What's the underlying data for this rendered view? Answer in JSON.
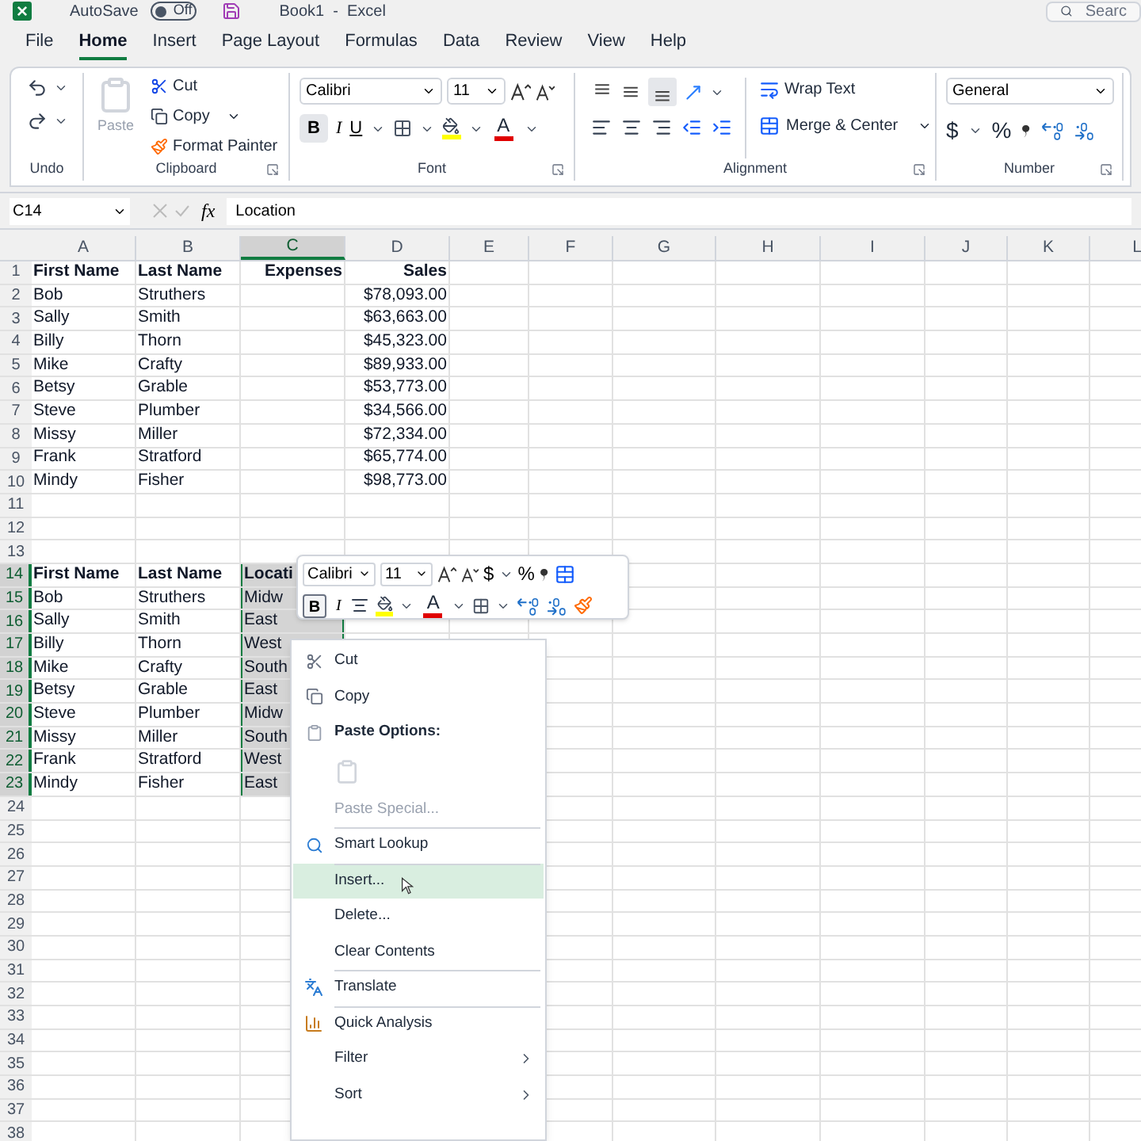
{
  "title_bar": {
    "autosave_label": "AutoSave",
    "autosave_state": "Off",
    "autosave_on": false,
    "document_title": "Book1  -  Excel",
    "search_placeholder": "Searc"
  },
  "tabs": [
    {
      "label": "File",
      "selected": false
    },
    {
      "label": "Home",
      "selected": true
    },
    {
      "label": "Insert",
      "selected": false
    },
    {
      "label": "Page Layout",
      "selected": false
    },
    {
      "label": "Formulas",
      "selected": false
    },
    {
      "label": "Data",
      "selected": false
    },
    {
      "label": "Review",
      "selected": false
    },
    {
      "label": "View",
      "selected": false
    },
    {
      "label": "Help",
      "selected": false
    }
  ],
  "ribbon": {
    "undo_group": "Undo",
    "clipboard": {
      "label": "Clipboard",
      "paste": "Paste",
      "paste_disabled": true,
      "cut": "Cut",
      "copy": "Copy",
      "format_painter": "Format Painter"
    },
    "font": {
      "label": "Font",
      "font_name": "Calibri",
      "font_size": "11",
      "bold": "B",
      "bold_selected": true,
      "italic": "I",
      "underline": "U",
      "font_color_letter": "A"
    },
    "alignment": {
      "label": "Alignment",
      "wrap_text": "Wrap Text",
      "merge_center": "Merge & Center",
      "bottom_align_selected": true
    },
    "number": {
      "label": "Number",
      "format": "General",
      "currency": "$",
      "percent": "%"
    }
  },
  "formula_bar": {
    "name_box": "C14",
    "fx": "fx",
    "value": "Location"
  },
  "grid": {
    "columns": [
      {
        "label": "A",
        "selected": false
      },
      {
        "label": "B",
        "selected": false
      },
      {
        "label": "C",
        "selected": true
      },
      {
        "label": "D",
        "selected": false
      },
      {
        "label": "E",
        "selected": false
      },
      {
        "label": "F",
        "selected": false
      },
      {
        "label": "G",
        "selected": false
      },
      {
        "label": "H",
        "selected": false
      },
      {
        "label": "I",
        "selected": false
      },
      {
        "label": "J",
        "selected": false
      },
      {
        "label": "K",
        "selected": false
      },
      {
        "label": "L",
        "selected": false
      }
    ],
    "rows": [
      {
        "number": "1",
        "selected": false,
        "bold": true,
        "cells": [
          {
            "text": "First Name"
          },
          {
            "text": "Last Name"
          },
          {
            "text": "Expenses",
            "right_aligned": true
          },
          {
            "text": "Sales",
            "right_aligned": true
          }
        ]
      },
      {
        "number": "2",
        "selected": false,
        "bold": false,
        "cells": [
          {
            "text": "Bob"
          },
          {
            "text": "Struthers"
          },
          {
            "text": ""
          },
          {
            "text": "$78,093.00",
            "right_aligned": true
          }
        ]
      },
      {
        "number": "3",
        "selected": false,
        "bold": false,
        "cells": [
          {
            "text": "Sally"
          },
          {
            "text": "Smith"
          },
          {
            "text": ""
          },
          {
            "text": "$63,663.00",
            "right_aligned": true
          }
        ]
      },
      {
        "number": "4",
        "selected": false,
        "bold": false,
        "cells": [
          {
            "text": "Billy"
          },
          {
            "text": "Thorn"
          },
          {
            "text": ""
          },
          {
            "text": "$45,323.00",
            "right_aligned": true
          }
        ]
      },
      {
        "number": "5",
        "selected": false,
        "bold": false,
        "cells": [
          {
            "text": "Mike"
          },
          {
            "text": "Crafty"
          },
          {
            "text": ""
          },
          {
            "text": "$89,933.00",
            "right_aligned": true
          }
        ]
      },
      {
        "number": "6",
        "selected": false,
        "bold": false,
        "cells": [
          {
            "text": "Betsy"
          },
          {
            "text": "Grable"
          },
          {
            "text": ""
          },
          {
            "text": "$53,773.00",
            "right_aligned": true
          }
        ]
      },
      {
        "number": "7",
        "selected": false,
        "bold": false,
        "cells": [
          {
            "text": "Steve"
          },
          {
            "text": "Plumber"
          },
          {
            "text": ""
          },
          {
            "text": "$34,566.00",
            "right_aligned": true
          }
        ]
      },
      {
        "number": "8",
        "selected": false,
        "bold": false,
        "cells": [
          {
            "text": "Missy"
          },
          {
            "text": "Miller"
          },
          {
            "text": ""
          },
          {
            "text": "$72,334.00",
            "right_aligned": true
          }
        ]
      },
      {
        "number": "9",
        "selected": false,
        "bold": false,
        "cells": [
          {
            "text": "Frank"
          },
          {
            "text": "Stratford"
          },
          {
            "text": ""
          },
          {
            "text": "$65,774.00",
            "right_aligned": true
          }
        ]
      },
      {
        "number": "10",
        "selected": false,
        "bold": false,
        "cells": [
          {
            "text": "Mindy"
          },
          {
            "text": "Fisher"
          },
          {
            "text": ""
          },
          {
            "text": "$98,773.00",
            "right_aligned": true
          }
        ]
      },
      {
        "number": "11",
        "selected": false
      },
      {
        "number": "12",
        "selected": false
      },
      {
        "number": "13",
        "selected": false
      },
      {
        "number": "14",
        "selected": true,
        "bold": true,
        "cells": [
          {
            "text": "First Name"
          },
          {
            "text": "Last Name"
          },
          {
            "text": "Locati",
            "selected": true
          }
        ]
      },
      {
        "number": "15",
        "selected": true,
        "bold": false,
        "cells": [
          {
            "text": "Bob"
          },
          {
            "text": "Struthers"
          },
          {
            "text": "Midw",
            "selected": true
          }
        ]
      },
      {
        "number": "16",
        "selected": true,
        "bold": false,
        "cells": [
          {
            "text": "Sally"
          },
          {
            "text": "Smith"
          },
          {
            "text": "East",
            "selected": true
          }
        ]
      },
      {
        "number": "17",
        "selected": true,
        "bold": false,
        "cells": [
          {
            "text": "Billy"
          },
          {
            "text": "Thorn"
          },
          {
            "text": "West",
            "selected": true
          }
        ]
      },
      {
        "number": "18",
        "selected": true,
        "bold": false,
        "cells": [
          {
            "text": "Mike"
          },
          {
            "text": "Crafty"
          },
          {
            "text": "South",
            "selected": true
          }
        ]
      },
      {
        "number": "19",
        "selected": true,
        "bold": false,
        "cells": [
          {
            "text": "Betsy"
          },
          {
            "text": "Grable"
          },
          {
            "text": "East",
            "selected": true
          }
        ]
      },
      {
        "number": "20",
        "selected": true,
        "bold": false,
        "cells": [
          {
            "text": "Steve"
          },
          {
            "text": "Plumber"
          },
          {
            "text": "Midw",
            "selected": true
          }
        ]
      },
      {
        "number": "21",
        "selected": true,
        "bold": false,
        "cells": [
          {
            "text": "Missy"
          },
          {
            "text": "Miller"
          },
          {
            "text": "South",
            "selected": true
          }
        ]
      },
      {
        "number": "22",
        "selected": true,
        "bold": false,
        "cells": [
          {
            "text": "Frank"
          },
          {
            "text": "Stratford"
          },
          {
            "text": "West",
            "selected": true
          }
        ]
      },
      {
        "number": "23",
        "selected": true,
        "bold": false,
        "cells": [
          {
            "text": "Mindy"
          },
          {
            "text": "Fisher"
          },
          {
            "text": "East",
            "selected": true
          }
        ]
      },
      {
        "number": "24",
        "selected": false
      },
      {
        "number": "25",
        "selected": false
      },
      {
        "number": "26",
        "selected": false
      },
      {
        "number": "27",
        "selected": false
      },
      {
        "number": "28",
        "selected": false
      },
      {
        "number": "29",
        "selected": false
      },
      {
        "number": "30",
        "selected": false
      },
      {
        "number": "31",
        "selected": false
      },
      {
        "number": "32",
        "selected": false
      },
      {
        "number": "33",
        "selected": false
      },
      {
        "number": "34",
        "selected": false
      },
      {
        "number": "35",
        "selected": false
      },
      {
        "number": "36",
        "selected": false
      },
      {
        "number": "37",
        "selected": false
      },
      {
        "number": "38",
        "selected": false
      }
    ]
  },
  "mini_toolbar": {
    "font_name": "Calibri",
    "font_size": "11",
    "currency": "$",
    "percent": "%",
    "bold": "B",
    "bold_selected": true,
    "italic": "I",
    "font_color_letter": "A"
  },
  "context_menu": [
    {
      "kind": "cut",
      "label": "Cut",
      "disabled": false,
      "selected": false,
      "divider_above": false
    },
    {
      "kind": "copy",
      "label": "Copy",
      "disabled": false,
      "selected": false,
      "divider_above": false
    },
    {
      "kind": "paste-heading",
      "label": "Paste Options:",
      "disabled": false,
      "selected": false,
      "divider_above": false
    },
    {
      "kind": "paste-button",
      "disabled": true,
      "selected": false,
      "divider_above": false
    },
    {
      "kind": "plain",
      "label": "Paste Special...",
      "disabled": true,
      "selected": false,
      "divider_above": false
    },
    {
      "kind": "lookup",
      "label": "Smart Lookup",
      "disabled": false,
      "selected": false,
      "divider_above": true
    },
    {
      "kind": "plain",
      "label": "Insert...",
      "disabled": false,
      "selected": true,
      "divider_above": true
    },
    {
      "kind": "plain",
      "label": "Delete...",
      "disabled": false,
      "selected": false,
      "divider_above": false
    },
    {
      "kind": "plain",
      "label": "Clear Contents",
      "disabled": false,
      "selected": false,
      "divider_above": false
    },
    {
      "kind": "translate",
      "label": "Translate",
      "disabled": false,
      "selected": false,
      "divider_above": true
    },
    {
      "kind": "analysis",
      "label": "Quick Analysis",
      "disabled": false,
      "selected": false,
      "divider_above": true
    },
    {
      "kind": "submenu",
      "label": "Filter",
      "disabled": false,
      "selected": false,
      "divider_above": false
    },
    {
      "kind": "submenu",
      "label": "Sort",
      "disabled": false,
      "selected": false,
      "divider_above": false
    }
  ]
}
